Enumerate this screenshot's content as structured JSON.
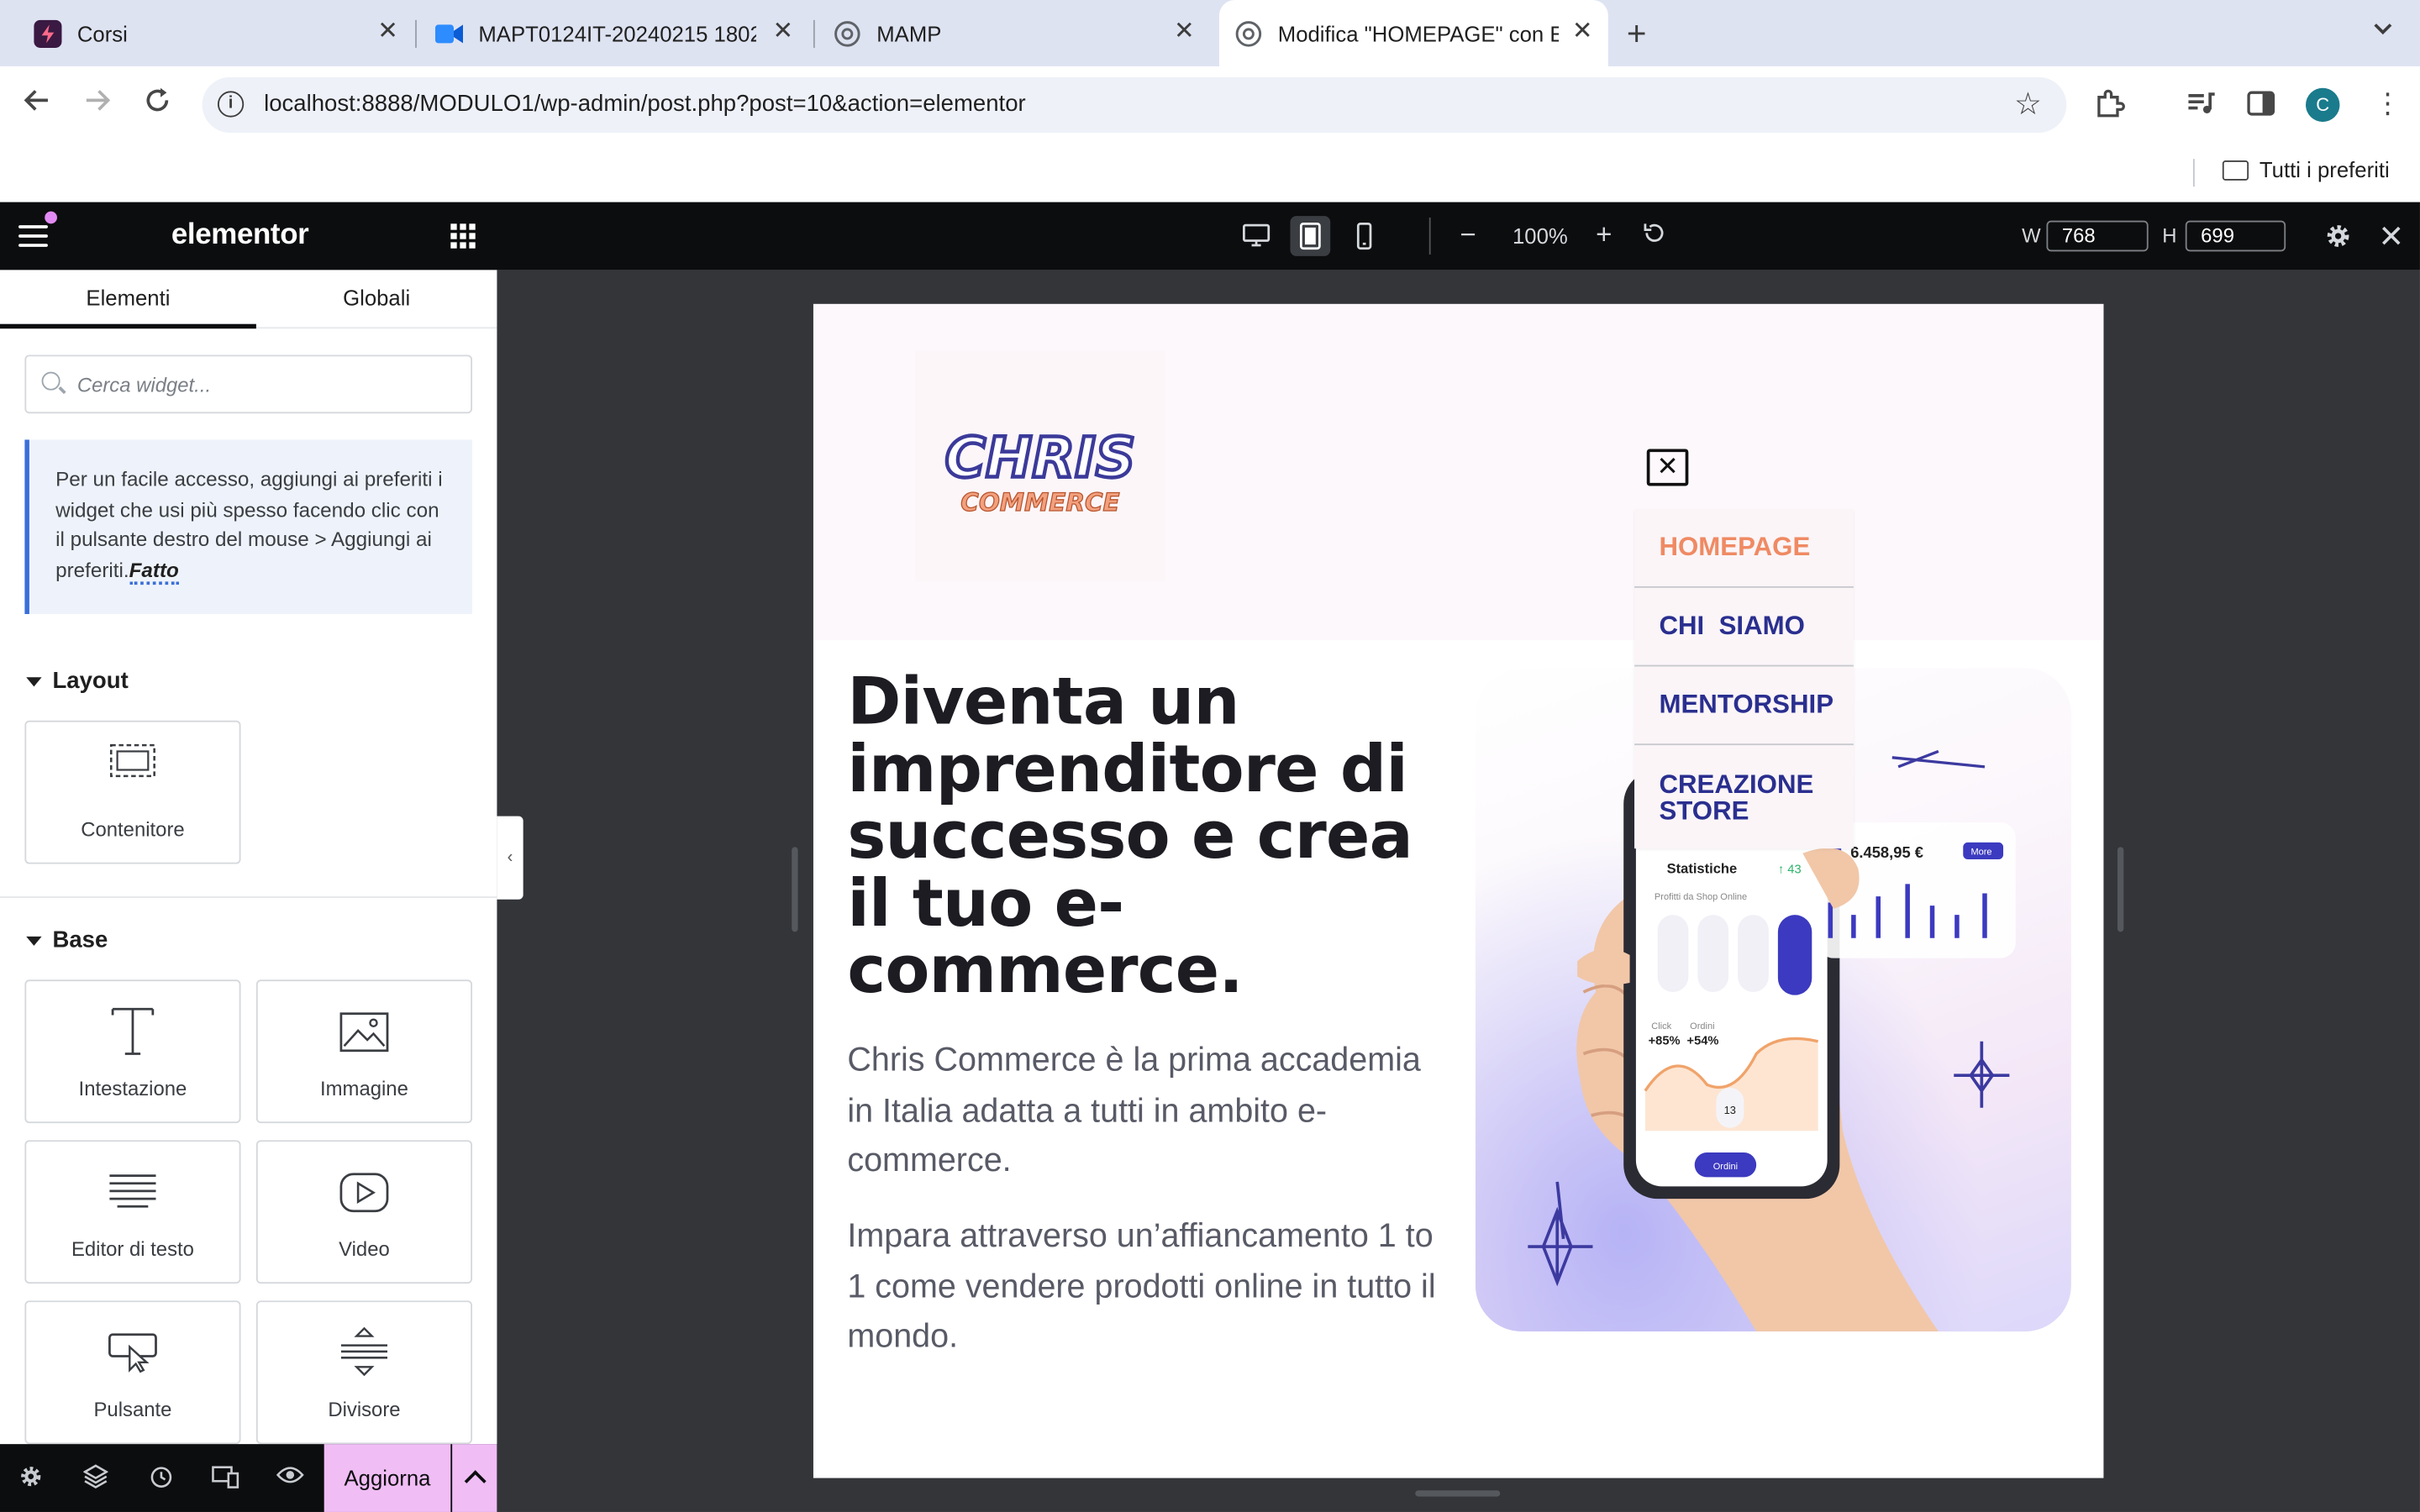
{
  "browser": {
    "tabs": [
      {
        "title": "Corsi",
        "icon": "zap-icon",
        "active": false
      },
      {
        "title": "MAPT0124IT-20240215 1802",
        "icon": "meet-icon",
        "active": false
      },
      {
        "title": "MAMP",
        "icon": "globe-icon",
        "active": false
      },
      {
        "title": "Modifica \"HOMEPAGE\" con El",
        "icon": "globe-icon",
        "active": true
      }
    ],
    "new_tab": "+",
    "url": "localhost:8888/MODULO1/wp-admin/post.php?post=10&action=elementor",
    "profile_initial": "C",
    "bookmarks_label": "Tutti i preferiti"
  },
  "editor": {
    "brand": "elementor",
    "zoom": "100%",
    "width_label": "W",
    "width_value": "768",
    "height_label": "H",
    "height_value": "699",
    "active_device": "tablet"
  },
  "panel": {
    "tabs": [
      "Elementi",
      "Globali"
    ],
    "search_placeholder": "Cerca widget...",
    "notice_text": "Per un facile accesso, aggiungi ai preferiti i widget che usi più spesso facendo clic con il pulsante destro del mouse > Aggiungi ai preferiti.",
    "notice_done": "Fatto",
    "sections": {
      "layout": "Layout",
      "base": "Base"
    },
    "layout_widgets": [
      {
        "label": "Contenitore",
        "icon": "container-icon"
      }
    ],
    "base_widgets": [
      {
        "label": "Intestazione",
        "icon": "heading-icon"
      },
      {
        "label": "Immagine",
        "icon": "image-icon"
      },
      {
        "label": "Editor di testo",
        "icon": "text-editor-icon"
      },
      {
        "label": "Video",
        "icon": "video-icon"
      },
      {
        "label": "Pulsante",
        "icon": "button-icon"
      },
      {
        "label": "Divisore",
        "icon": "divider-icon"
      }
    ],
    "update_label": "Aggiorna"
  },
  "page": {
    "logo_line1": "CHRIS",
    "logo_line2": "COMMERCE",
    "menu_items": [
      "HOMEPAGE",
      "CHI  SIAMO",
      "MENTORSHIP",
      "CREAZIONE STORE"
    ],
    "hero_title": "Diventa un imprenditore di successo e crea il tuo e-commerce.",
    "hero_p1": "Chris Commerce è la prima accademia in Italia adatta a tutti in ambito e-commerce.",
    "hero_p2": "Impara attraverso un’affiancamento 1 to 1 come vendere prodotti online in tutto il mondo.",
    "mockup": {
      "stats_title": "Statistiche",
      "stats_sub": "Profitti da Shop Online",
      "amount": "6.458,95 €",
      "more": "More",
      "click_label": "Click",
      "click_value": "+85%",
      "orders_label": "Ordini",
      "orders_value": "+54%",
      "day": "13",
      "orders_btn": "Ordini",
      "growth": "↑ 43"
    }
  },
  "colors": {
    "accent_pink": "#f0bdf5",
    "menu_blue": "#2a2f8f",
    "menu_active": "#ef8a63",
    "editor_dark": "#0c0d0e"
  }
}
